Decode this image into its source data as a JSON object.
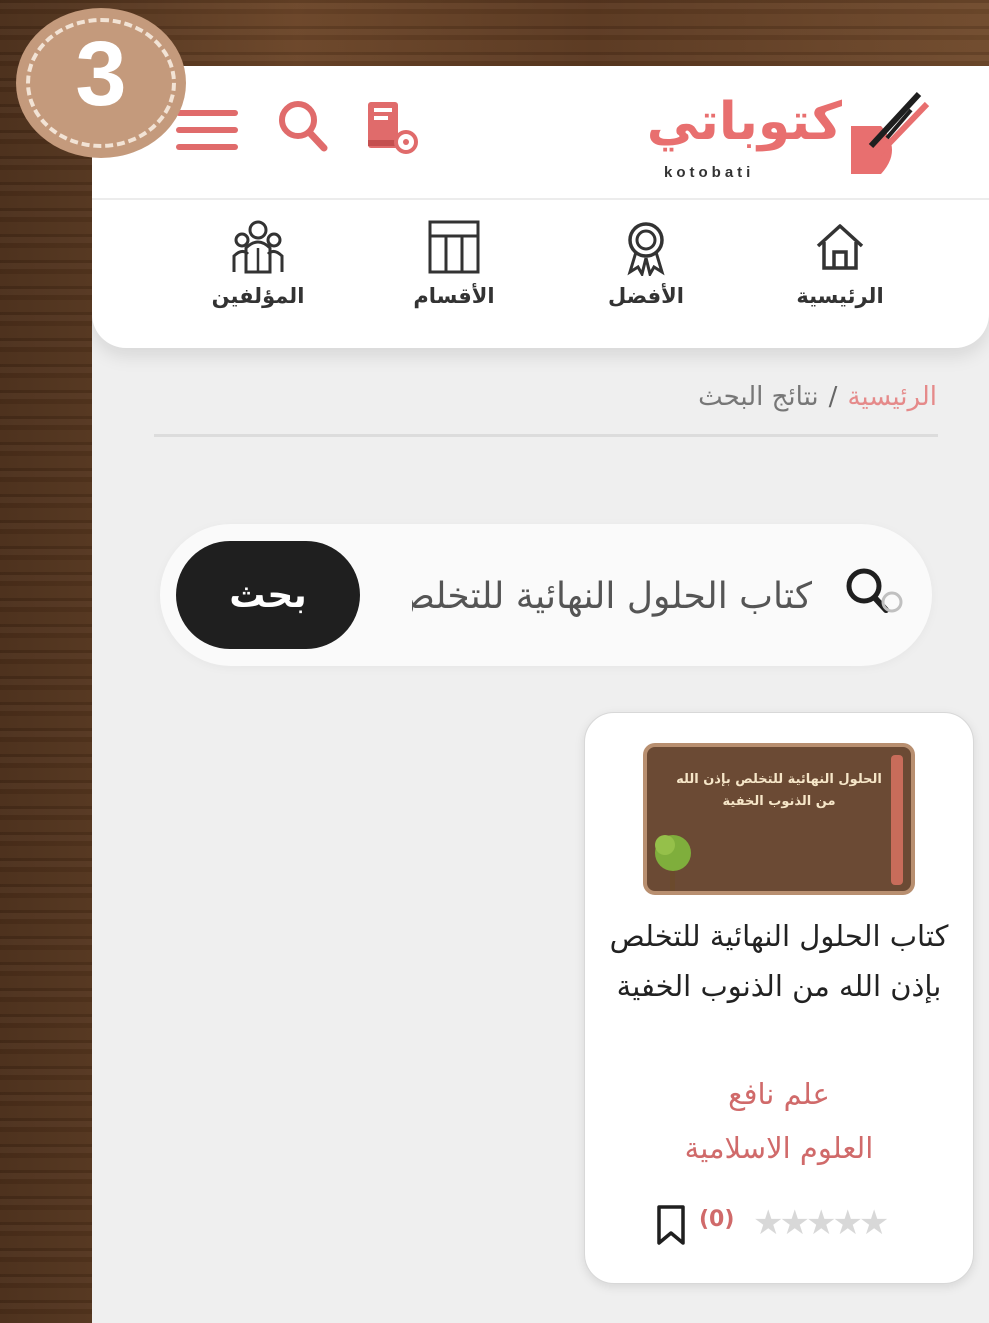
{
  "step_badge": "3",
  "header": {
    "logo_text": "كتوباتي",
    "logo_sub": "kotobati",
    "menu_icon": "menu-icon",
    "search_icon": "search-icon",
    "library_icon": "book-icon"
  },
  "nav": {
    "items": [
      {
        "label": "الرئيسية",
        "icon": "home-icon"
      },
      {
        "label": "الأفضل",
        "icon": "award-icon"
      },
      {
        "label": "الأقسام",
        "icon": "grid-icon"
      },
      {
        "label": "المؤلفين",
        "icon": "authors-icon"
      }
    ]
  },
  "breadcrumb": {
    "home": "الرئيسية",
    "separator": "/",
    "current": "نتائج البحث"
  },
  "search": {
    "value": "كتاب الحلول النهائية للتخلص بإذن الله من الذنوب الخفية",
    "button_label": "بحث"
  },
  "results": [
    {
      "cover_title": "الحلول النهائية للتخلص بإذن الله من الذنوب الخفية",
      "title": "كتاب الحلول النهائية للتخلص بإذن الله من الذنوب الخفية",
      "author": "علم نافع",
      "category": "العلوم الاسلامية",
      "rating_count": "(0)",
      "stars": "★★★★★"
    }
  ],
  "colors": {
    "accent": "#e06b6b",
    "button_dark": "#1f1f1f",
    "background": "#efefef"
  }
}
